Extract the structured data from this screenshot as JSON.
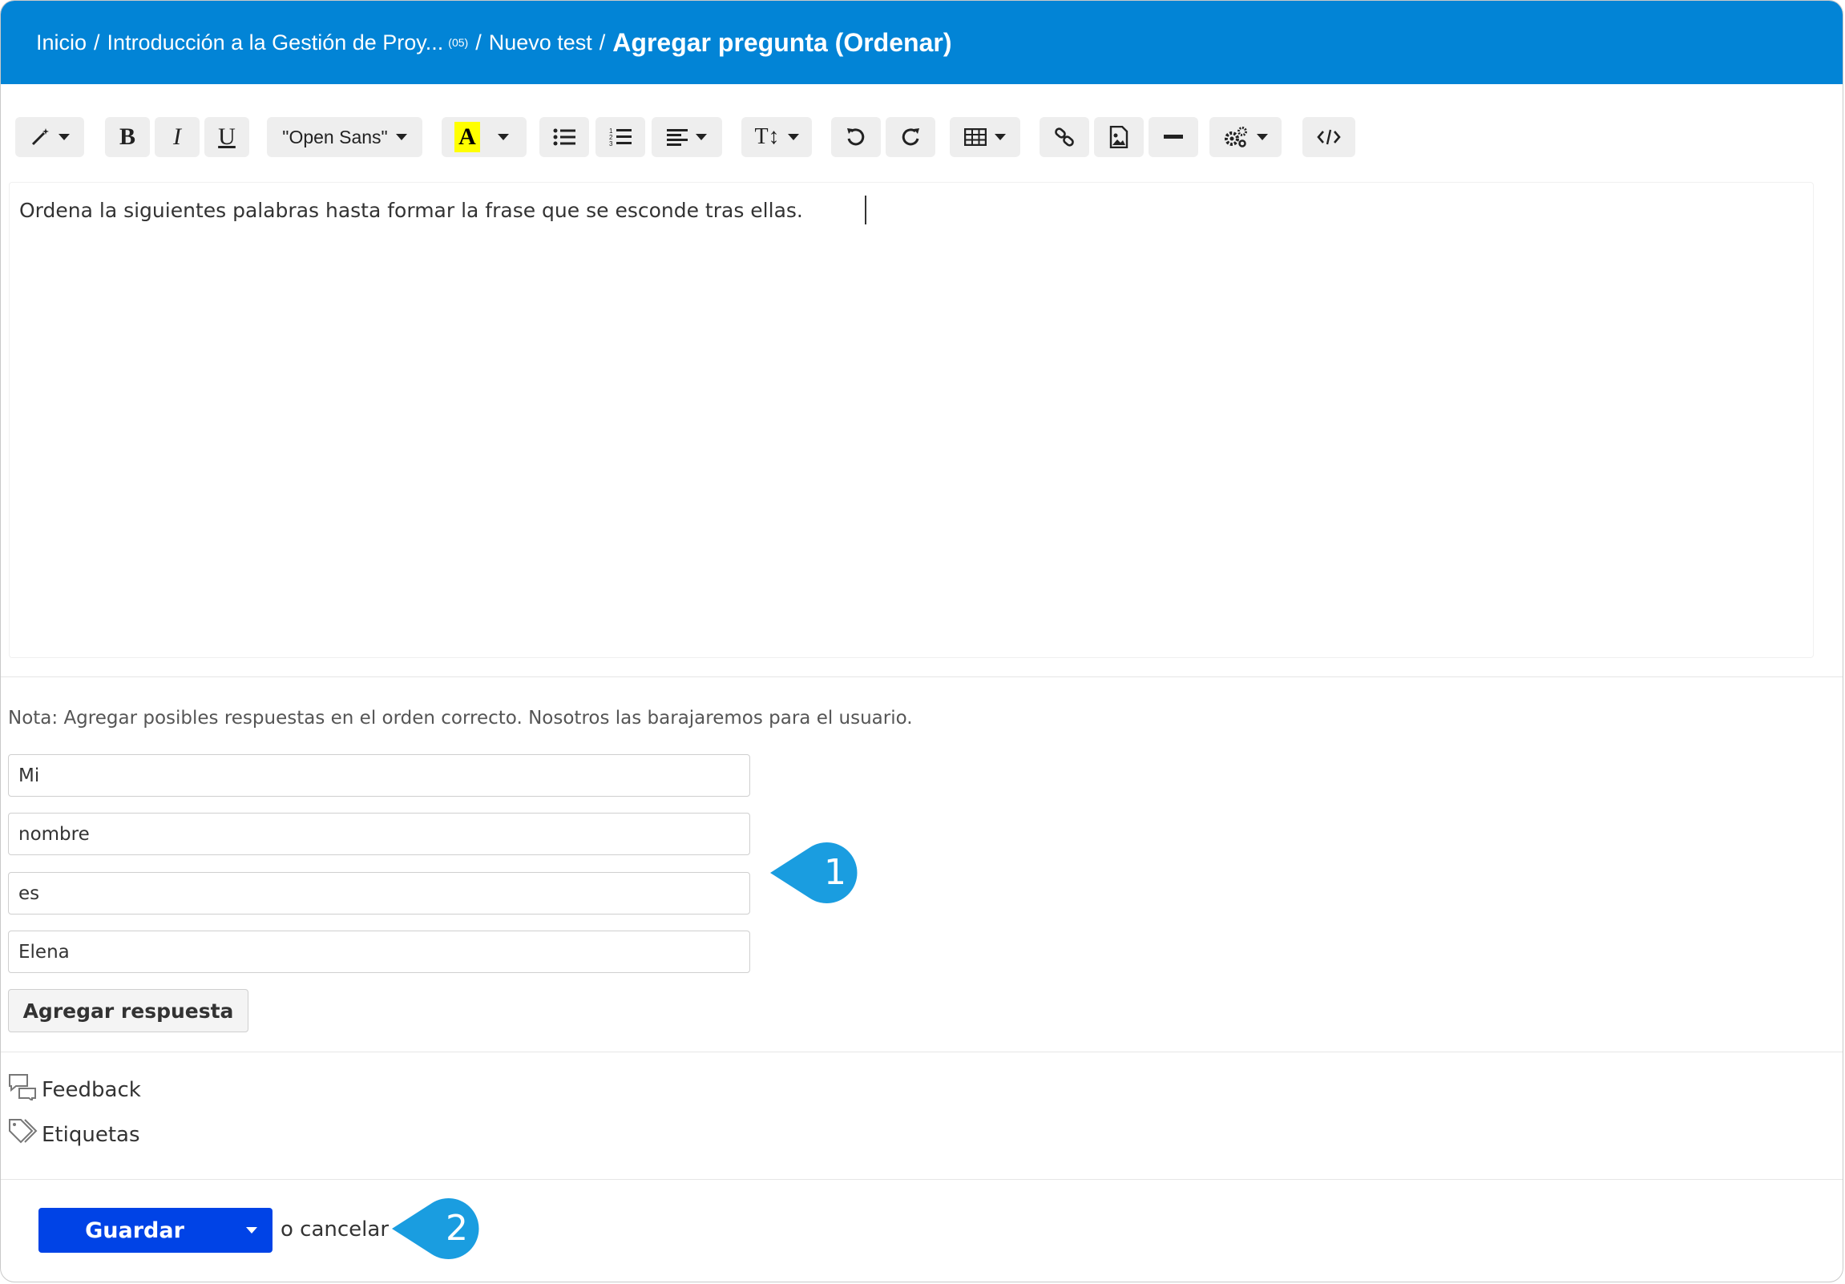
{
  "breadcrumb": {
    "home": "Inicio",
    "course": "Introducción a la Gestión de Proy...",
    "course_count": "(05)",
    "test": "Nuevo test",
    "current": "Agregar pregunta (Ordenar)",
    "separator": "/"
  },
  "toolbar": {
    "bold": "B",
    "italic": "I",
    "underline": "U",
    "font": "\"Open Sans\"",
    "highlight": "A",
    "text_size": "T↕",
    "icons": [
      "magic-wand-icon",
      "bold-icon",
      "italic-icon",
      "underline-icon",
      "font-family-select",
      "text-color-icon",
      "unordered-list-icon",
      "ordered-list-icon",
      "align-icon",
      "text-size-icon",
      "undo-icon",
      "redo-icon",
      "table-icon",
      "link-icon",
      "image-icon",
      "horizontal-rule-icon",
      "settings-icon",
      "code-view-icon"
    ],
    "highlight_color": "#ffff00"
  },
  "editor": {
    "content": "Ordena la siguientes palabras hasta formar la frase que se esconde tras ellas."
  },
  "note": "Nota: Agregar posibles respuestas en el orden correcto. Nosotros las barajaremos para el usuario.",
  "answers": [
    "Mi",
    "nombre",
    "es",
    "Elena"
  ],
  "add_answer_label": "Agregar respuesta",
  "sections": {
    "feedback": "Feedback",
    "tags": "Etiquetas"
  },
  "footer": {
    "save_label": "Guardar",
    "cancel_label": "o cancelar"
  },
  "callouts": [
    "1",
    "2"
  ],
  "colors": {
    "header_bg": "#0284d6",
    "save_bg": "#0043e6",
    "callout": "#1a9de0"
  }
}
